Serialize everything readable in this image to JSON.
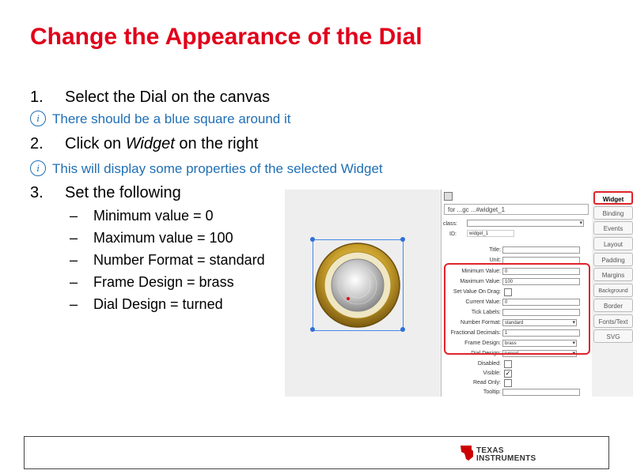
{
  "slide": {
    "title": "Change the Appearance of the Dial",
    "steps": [
      {
        "num": "1.",
        "text": "Select the Dial on the canvas"
      },
      {
        "num": "2.",
        "text_before": "Click on ",
        "text_italic": "Widget",
        "text_after": " on the right"
      },
      {
        "num": "3.",
        "text": "Set the following"
      }
    ],
    "notes": [
      "There should be a blue square around it",
      "This will display some properties of the selected Widget"
    ],
    "settings": [
      "Minimum value = 0",
      "Maximum value = 100",
      "Number Format = standard",
      "Frame Design = brass",
      "Dial Design = turned"
    ],
    "dash": "–",
    "info_glyph": "i"
  },
  "screenshot": {
    "path": "for ...gc ...#widget_1",
    "fields": {
      "class_label": "class:",
      "id_label": "ID:",
      "id_value": "widget_1",
      "title": "Title:",
      "unit": "Unit:",
      "minimum_value": "Minimum Value:",
      "minimum_value_val": "0",
      "maximum_value": "Maximum Value:",
      "maximum_value_val": "100",
      "set_value_on_drag": "Set Value On Drag:",
      "current_value": "Current Value:",
      "current_value_val": "0",
      "tick_labels": "Tick Labels:",
      "number_format": "Number Format:",
      "number_format_val": "standard",
      "fractional_decimals": "Fractional Decimals:",
      "fractional_decimals_val": "1",
      "frame_design": "Frame Design:",
      "frame_design_val": "brass",
      "dial_design": "Dial Design:",
      "dial_design_val": "turned",
      "disabled": "Disabled:",
      "visible": "Visible:",
      "read_only": "Read Only:",
      "tooltip": "Tooltip:"
    },
    "tabs": [
      "Widget",
      "Binding",
      "Events",
      "Layout",
      "Padding",
      "Margins",
      "Background",
      "Border",
      "Fonts/Text",
      "SVG"
    ],
    "active_tab": "Widget"
  },
  "footer": {
    "logo_line1": "TEXAS",
    "logo_line2": "INSTRUMENTS",
    "brand_color": "#cc0000"
  },
  "colors": {
    "title": "#e0001a",
    "note": "#1f6fb5",
    "highlight": "#e0242a",
    "selection": "#4a86e8"
  }
}
